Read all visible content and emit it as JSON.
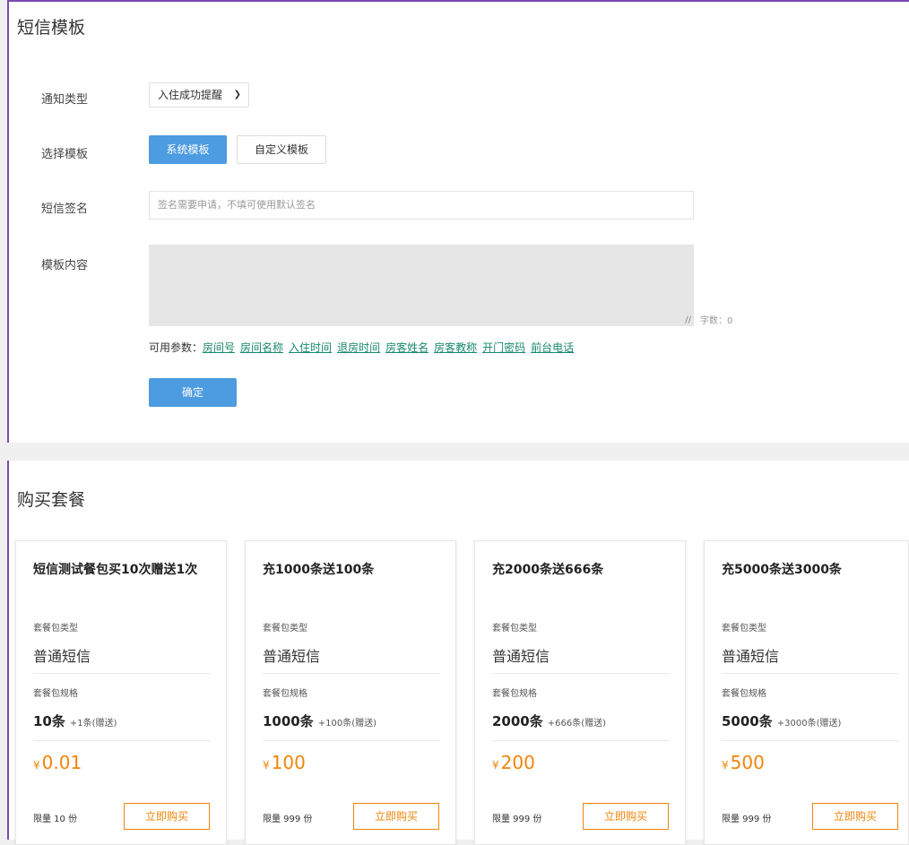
{
  "sms_template": {
    "title": "短信模板",
    "notify_type": {
      "label": "通知类型",
      "value": "入住成功提醒"
    },
    "template_choice": {
      "label": "选择模板",
      "system_btn": "系统模板",
      "custom_btn": "自定义模板"
    },
    "signature": {
      "label": "短信签名",
      "placeholder": "签名需要申请，不填可使用默认签名"
    },
    "content": {
      "label": "模板内容",
      "char_count": "字数：0"
    },
    "params": {
      "prefix": "可用参数：",
      "items": [
        "房间号",
        "房间名称",
        "入住时间",
        "退房时间",
        "房客姓名",
        "房客教称",
        "开门密码",
        "前台电话"
      ]
    },
    "confirm_btn": "确定"
  },
  "packages": {
    "title": "购买套餐",
    "type_label": "套餐包类型",
    "spec_label": "套餐包规格",
    "buy_btn": "立即购买",
    "currency": "¥",
    "cards": [
      {
        "name": "短信测试餐包买10次赠送1次",
        "type": "普通短信",
        "spec": "10条",
        "bonus": "+1条(赠送)",
        "price": "0.01",
        "limit": "限量 10 份"
      },
      {
        "name": "充1000条送100条",
        "type": "普通短信",
        "spec": "1000条",
        "bonus": "+100条(赠送)",
        "price": "100",
        "limit": "限量 999 份"
      },
      {
        "name": "充2000条送666条",
        "type": "普通短信",
        "spec": "2000条",
        "bonus": "+666条(赠送)",
        "price": "200",
        "limit": "限量 999 份"
      },
      {
        "name": "充5000条送3000条",
        "type": "普通短信",
        "spec": "5000条",
        "bonus": "+3000条(赠送)",
        "price": "500",
        "limit": "限量 999 份"
      }
    ]
  },
  "colors": {
    "primary": "#4d9be0",
    "accent": "#f0850a",
    "link": "#1a8a6e",
    "frame": "#7b4ab0"
  }
}
